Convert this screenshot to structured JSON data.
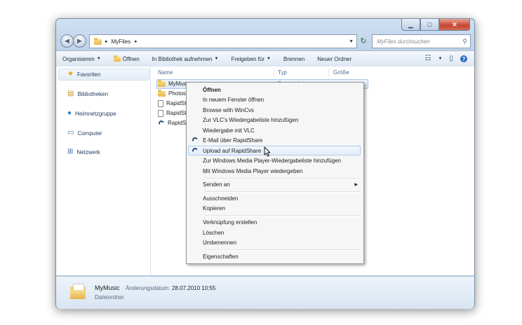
{
  "address": {
    "crumb_glyph": "▸",
    "path": "MyFiles",
    "arrow": "▸"
  },
  "search": {
    "placeholder": "MyFiles durchsuchen"
  },
  "toolbar": {
    "organize": "Organisieren",
    "open": "Öffnen",
    "library": "In Bibliothek aufnehmen",
    "share": "Freigeben für",
    "burn": "Brennen",
    "new_folder": "Neuer Ordner"
  },
  "sidebar": {
    "items": [
      {
        "label": "Favoriten",
        "icon": "star-icon"
      },
      {
        "label": "Bibliotheken",
        "icon": "library-icon"
      },
      {
        "label": "Heimnetzgruppe",
        "icon": "homegroup-icon"
      },
      {
        "label": "Computer",
        "icon": "computer-icon"
      },
      {
        "label": "Netzwerk",
        "icon": "network-icon"
      }
    ]
  },
  "columns": {
    "name": "Name",
    "type": "Typ",
    "size": "Größe"
  },
  "files": [
    {
      "name": "MyMusic",
      "icon": "folder-icon",
      "type": "Dateiordner"
    },
    {
      "name": "Photos",
      "icon": "folder-icon"
    },
    {
      "name": "RapidSh",
      "icon": "document-icon"
    },
    {
      "name": "RapidSh",
      "icon": "document-icon"
    },
    {
      "name": "RapidSh",
      "icon": "rapidshare-icon"
    }
  ],
  "context_menu": {
    "groups": [
      [
        "Öffnen",
        "In neuem Fenster öffnen",
        "Browse with WinCvs",
        "Zur VLC's Wiedergabeliste hinzufügen",
        "Wiedergabe mit VLC",
        "E-Mail über RapidShare",
        "Upload auf RapidShare",
        "Zur Windows Media Player-Wiedergabeliste hinzufügen",
        "Mit Windows Media Player wiedergeben"
      ],
      [
        "Senden an"
      ],
      [
        "Ausschneiden",
        "Kopieren"
      ],
      [
        "Verknüpfung erstellen",
        "Löschen",
        "Umbenennen"
      ],
      [
        "Eigenschaften"
      ]
    ],
    "hovered": "Upload auf RapidShare"
  },
  "status": {
    "name": "MyMusic",
    "date_label": "Änderungsdatum:",
    "date_value": "28.07.2010 10:55",
    "type": "Dateiordner"
  },
  "colors": {
    "accent": "#1e3a5f",
    "hover_border": "#aecbee"
  }
}
